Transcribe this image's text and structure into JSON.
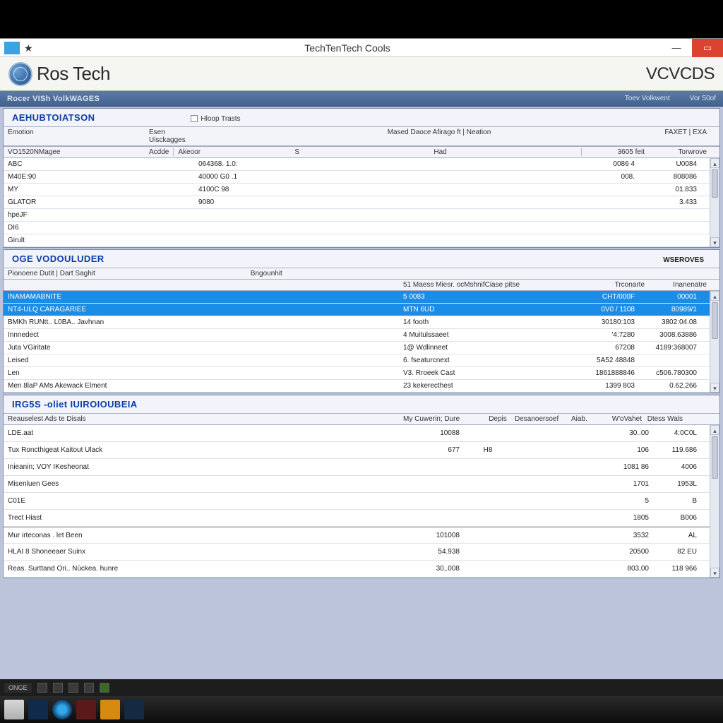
{
  "titlebar": {
    "title": "TechTenTech Cools",
    "minimize": "—",
    "close": "▭"
  },
  "header": {
    "app_name": "Ros Tech",
    "brand": "VCVCDS"
  },
  "bluebar": {
    "subtitle": "Rocer VISh VolkWAGES",
    "right1": "Toev Volkwent",
    "right2": "Vor 50of"
  },
  "panel1": {
    "title": "AEHUBTOIATSON",
    "chk_label": "Hloop Trasts",
    "col_emoton": "Emotion",
    "col_esen": "Esen Uisckagges",
    "col_acde": "Acdde",
    "col_akeor": "Akeoor",
    "col_mmr": "Mased Daoce Afirago ft | Neation",
    "col_36ds": "3605 feit",
    "col_torwore": "Torwrove",
    "col_faxet": "FAXET | EXA",
    "rows": [
      {
        "c1": "VO1520NMagee",
        "c2": "",
        "c3": "S",
        "c4": "Had",
        "c5": "",
        "c6": ""
      },
      {
        "c1": "ABC",
        "c2": "",
        "c3": "064368. 1.0:",
        "c4": "",
        "c5": "0086 4",
        "c6": "U0084"
      },
      {
        "c1": "M40E:90",
        "c2": "",
        "c3": "40000 G0 .1",
        "c4": "",
        "c5": "008.",
        "c6": "808086"
      },
      {
        "c1": "MY",
        "c2": "",
        "c3": "4100C 98",
        "c4": "",
        "c5": "",
        "c6": "01.833"
      },
      {
        "c1": "GLATOR",
        "c2": "",
        "c3": "9080",
        "c4": "",
        "c5": "",
        "c6": "3.433"
      },
      {
        "c1": "hpeJF",
        "c2": "",
        "c3": "",
        "c4": "",
        "c5": "",
        "c6": ""
      },
      {
        "c1": "DI6",
        "c2": "",
        "c3": "",
        "c4": "",
        "c5": "",
        "c6": ""
      },
      {
        "c1": "Girult",
        "c2": "",
        "c3": "",
        "c4": "",
        "c5": "",
        "c6": ""
      }
    ]
  },
  "panel2": {
    "title": "OGE VODOULUDER",
    "subheader": "Pionoene Dutit | Dart Saghit",
    "sub_c2": "Bngounhit",
    "right_label": "WSEROVES",
    "col_desc": "51 Maess Miesr. ocMshnifCiase pitse",
    "col_tc": "Trconarte",
    "col_ins": "Inanenatre",
    "rows": [
      {
        "c1": "INAMAMABNITE",
        "c2": "5 0083",
        "c3": "CHT/000F",
        "c4": "00001"
      },
      {
        "c1": "NT4-ULQ CARAGARIEE",
        "c2": "MTN 6UD",
        "c3": "0V0 / 1108",
        "c4": "80989/1"
      },
      {
        "c1": "BMKh RUNtt.. L0BA.. Javhnan",
        "c2": "14 footh",
        "c3": "30180:103",
        "c4": "3802:04.08"
      },
      {
        "c1": "Innnedect",
        "c2": "4 Muitulssaeet",
        "c3": "'4:7280",
        "c4": "3008.63886"
      },
      {
        "c1": "Juta VGiritate",
        "c2": "1@ Wdlinneet",
        "c3": "67208",
        "c4": "4189:368007"
      },
      {
        "c1": "Leised",
        "c2": "6. fseaturcnext",
        "c3": "5A52 48848",
        "c4": ""
      },
      {
        "c1": "Len",
        "c2": "V3. Rroeek Cast",
        "c3": "1861888846",
        "c4": "c506.780300"
      },
      {
        "c1": "Men 8laP AMs Akewack Elment",
        "c2": "23 kekerecthest",
        "c3": "1399 803",
        "c4": "0.62.266"
      }
    ]
  },
  "panel3": {
    "title": "IRG5S -oliet IUIROIOUBEIA",
    "subheader": "Reauselest Ads te Disals",
    "col_my": "My Cuwerin; Dure",
    "col_dep": "Depis",
    "col_desa": "Desanoersoef",
    "col_aiab": "Aiab.",
    "col_wov": "W'oVahet",
    "col_dess": "Dtess Wals",
    "rows": [
      {
        "c1": "LDE.aat",
        "c2": "10088",
        "c3": "",
        "c4": "",
        "c5": "30..00",
        "c6": "4:0C0L"
      },
      {
        "c1": "Tux Roncthigeat Kaitout Ulack",
        "c2": "677",
        "c3": "H8",
        "c4": "",
        "c5": "106",
        "c6": "119.686"
      },
      {
        "c1": "Inieanin; VOY IKesheonat",
        "c2": "",
        "c3": "",
        "c4": "",
        "c5": "1081 86",
        "c6": "4006"
      },
      {
        "c1": "Misenluen Gees",
        "c2": "",
        "c3": "",
        "c4": "",
        "c5": "1701",
        "c6": "1953L"
      },
      {
        "c1": "C01E",
        "c2": "",
        "c3": "",
        "c4": "",
        "c5": "5",
        "c6": "B"
      },
      {
        "c1": "Trect Hiast",
        "c2": "",
        "c3": "",
        "c4": "",
        "c5": "1805",
        "c6": "B006"
      },
      {
        "c1": "Mur irteconas . let Been",
        "c2": "101008",
        "c3": "",
        "c4": "",
        "c5": "3532",
        "c6": "AL"
      },
      {
        "c1": "HLAI 8 Shoneeaer Suinx",
        "c2": "54.938",
        "c3": "",
        "c4": "",
        "c5": "20500",
        "c6": "82 EU"
      },
      {
        "c1": "Reas. Surttand Ori.. Nùckea. hunre",
        "c2": "30,.008",
        "c3": "",
        "c4": "",
        "c5": "803,00",
        "c6": "118 966"
      }
    ]
  },
  "grey_strip": {
    "label": "ONGE"
  }
}
